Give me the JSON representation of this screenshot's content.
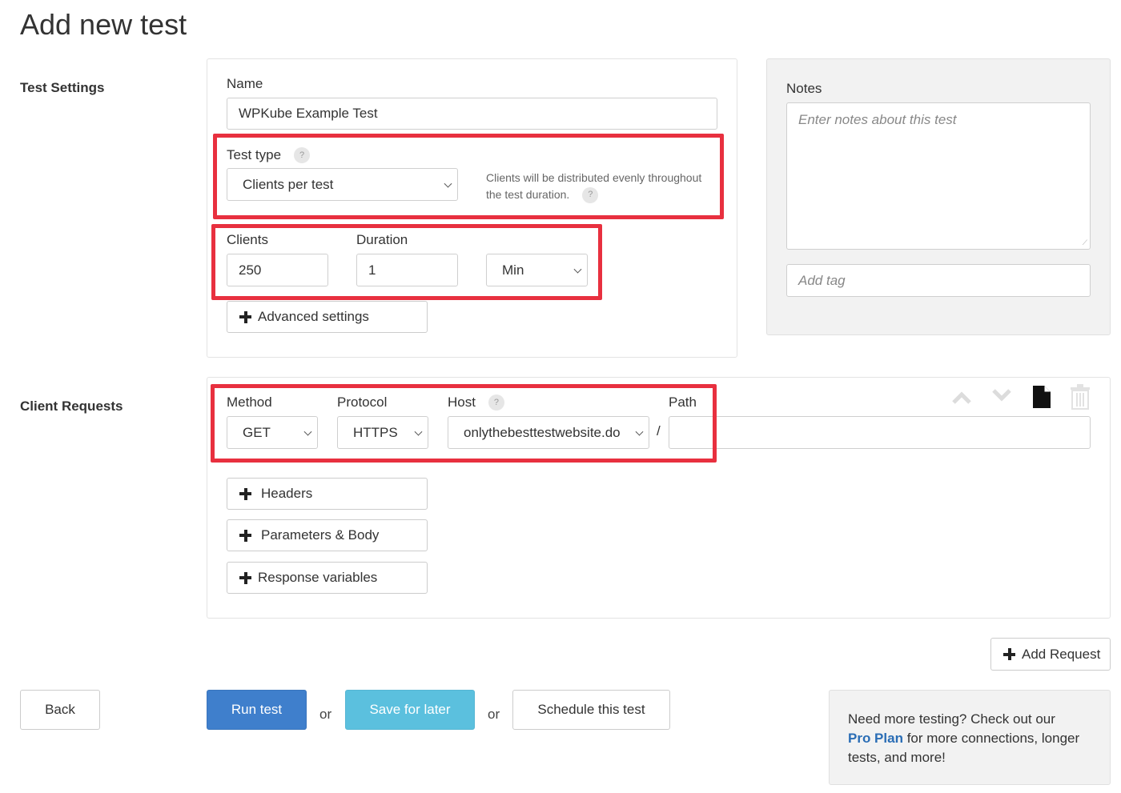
{
  "page_title": "Add new test",
  "test_settings": {
    "section_label": "Test Settings",
    "name_label": "Name",
    "name_value": "WPKube Example Test",
    "test_type_label": "Test type",
    "test_type_help": "?",
    "test_type_value": "Clients per test",
    "test_type_hint_line1": "Clients will be distributed evenly throughout",
    "test_type_hint_line2": "the test duration.",
    "clients_label": "Clients",
    "clients_value": "250",
    "duration_label": "Duration",
    "duration_value": "1",
    "duration_unit": "Min",
    "advanced_settings": "Advanced settings"
  },
  "notes": {
    "label": "Notes",
    "placeholder": "Enter notes about this test",
    "tag_placeholder": "Add tag"
  },
  "client_requests": {
    "section_label": "Client Requests",
    "method_label": "Method",
    "method_value": "GET",
    "protocol_label": "Protocol",
    "protocol_value": "HTTPS",
    "host_label": "Host",
    "host_value": "onlythebesttestwebsite.do",
    "separator": "/",
    "path_label": "Path",
    "path_value": "",
    "headers": "Headers",
    "params_body": "Parameters & Body",
    "response_variables": "Response variables",
    "add_request": "Add Request"
  },
  "actions": {
    "back": "Back",
    "run_test": "Run test",
    "or": "or",
    "save_for_later": "Save for later",
    "schedule": "Schedule this test"
  },
  "promo": {
    "line1": "Need more testing? Check out our",
    "link": "Pro Plan",
    "line2": " for more connections, longer",
    "line3": "tests, and more!"
  },
  "colors": {
    "highlight": "#e8303f",
    "run_button": "#3f7fcc",
    "save_button": "#5bc0de",
    "link": "#2a6db5"
  }
}
